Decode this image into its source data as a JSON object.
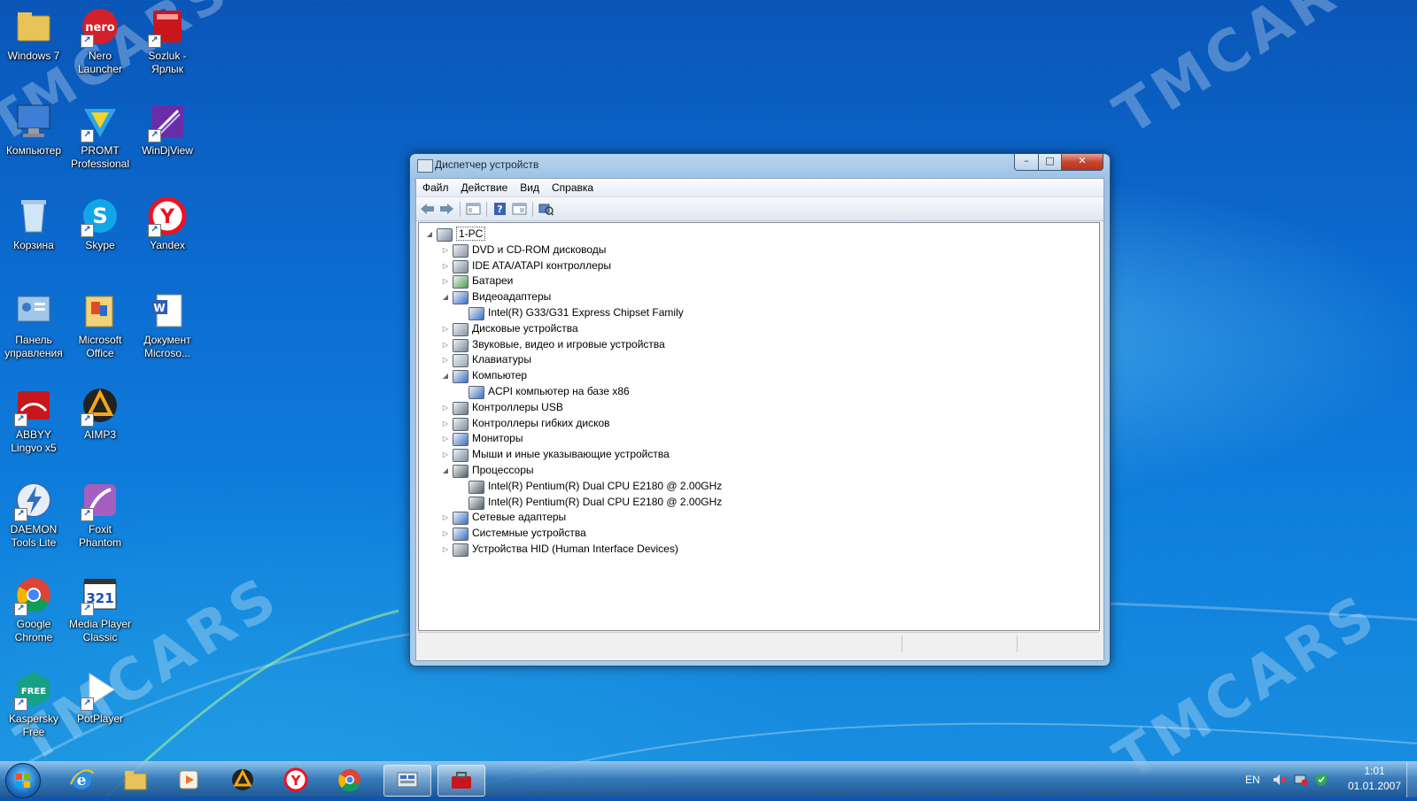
{
  "desktop": {
    "icons": [
      {
        "label": "Windows 7",
        "icon": "folder-icon"
      },
      {
        "label": "Nero Launcher",
        "icon": "nero-icon"
      },
      {
        "label": "Sozluk - Ярлык",
        "icon": "dictionary-book-icon"
      },
      {
        "label": "Компьютер",
        "icon": "computer-icon"
      },
      {
        "label": "PROMT Professional",
        "icon": "promt-icon"
      },
      {
        "label": "WinDjView",
        "icon": "windjview-icon"
      },
      {
        "label": "Корзина",
        "icon": "recycle-bin-icon"
      },
      {
        "label": "Skype",
        "icon": "skype-icon"
      },
      {
        "label": "Yandex",
        "icon": "yandex-browser-icon"
      },
      {
        "label": "Панель управления",
        "icon": "control-panel-icon"
      },
      {
        "label": "Microsoft Office",
        "icon": "office-folder-icon"
      },
      {
        "label": "Документ Microso...",
        "icon": "word-document-icon"
      },
      {
        "label": "ABBYY Lingvo x5",
        "icon": "abbyy-lingvo-icon"
      },
      {
        "label": "AIMP3",
        "icon": "aimp-icon"
      },
      {
        "label": "DAEMON Tools Lite",
        "icon": "daemon-tools-icon"
      },
      {
        "label": "Foxit Phantom",
        "icon": "foxit-icon"
      },
      {
        "label": "Google Chrome",
        "icon": "chrome-icon"
      },
      {
        "label": "Media Player Classic",
        "icon": "media-player-classic-icon"
      },
      {
        "label": "Kaspersky Free",
        "icon": "kaspersky-icon"
      },
      {
        "label": "PotPlayer",
        "icon": "potplayer-icon"
      }
    ],
    "watermark": "TMCARS"
  },
  "window": {
    "title": "Диспетчер устройств",
    "menu": [
      "Файл",
      "Действие",
      "Вид",
      "Справка"
    ],
    "toolbar": [
      "back-icon",
      "forward-icon",
      "show-hide-console-tree-icon",
      "help-icon",
      "properties-icon",
      "scan-hardware-icon"
    ],
    "tree": {
      "root": "1-PC",
      "nodes": [
        {
          "label": "DVD и CD-ROM дисководы",
          "expanded": false,
          "children": []
        },
        {
          "label": "IDE ATA/ATAPI контроллеры",
          "expanded": false,
          "children": []
        },
        {
          "label": "Батареи",
          "expanded": false,
          "children": []
        },
        {
          "label": "Видеоадаптеры",
          "expanded": true,
          "children": [
            "Intel(R) G33/G31 Express Chipset Family"
          ]
        },
        {
          "label": "Дисковые устройства",
          "expanded": false,
          "children": []
        },
        {
          "label": "Звуковые, видео и игровые устройства",
          "expanded": false,
          "children": []
        },
        {
          "label": "Клавиатуры",
          "expanded": false,
          "children": []
        },
        {
          "label": "Компьютер",
          "expanded": true,
          "children": [
            "ACPI компьютер на базе x86"
          ]
        },
        {
          "label": "Контроллеры USB",
          "expanded": false,
          "children": []
        },
        {
          "label": "Контроллеры гибких дисков",
          "expanded": false,
          "children": []
        },
        {
          "label": "Мониторы",
          "expanded": false,
          "children": []
        },
        {
          "label": "Мыши и иные указывающие устройства",
          "expanded": false,
          "children": []
        },
        {
          "label": "Процессоры",
          "expanded": true,
          "children": [
            "Intel(R) Pentium(R) Dual  CPU  E2180  @ 2.00GHz",
            "Intel(R) Pentium(R) Dual  CPU  E2180  @ 2.00GHz"
          ]
        },
        {
          "label": "Сетевые адаптеры",
          "expanded": false,
          "children": []
        },
        {
          "label": "Системные устройства",
          "expanded": false,
          "children": []
        },
        {
          "label": "Устройства HID (Human Interface Devices)",
          "expanded": false,
          "children": []
        }
      ]
    }
  },
  "taskbar": {
    "items": [
      "internet-explorer-icon",
      "explorer-folder-icon",
      "media-player-icon",
      "aimp-icon",
      "yandex-browser-icon",
      "chrome-icon",
      "device-manager-icon",
      "toolbox-icon"
    ],
    "active_index": 6,
    "tray": {
      "language": "EN",
      "time": "1:01",
      "date": "01.01.2007"
    }
  },
  "colors": {
    "accent": "#0c6cd0",
    "close_button": "#c7452f",
    "selection": "#3399ff"
  }
}
